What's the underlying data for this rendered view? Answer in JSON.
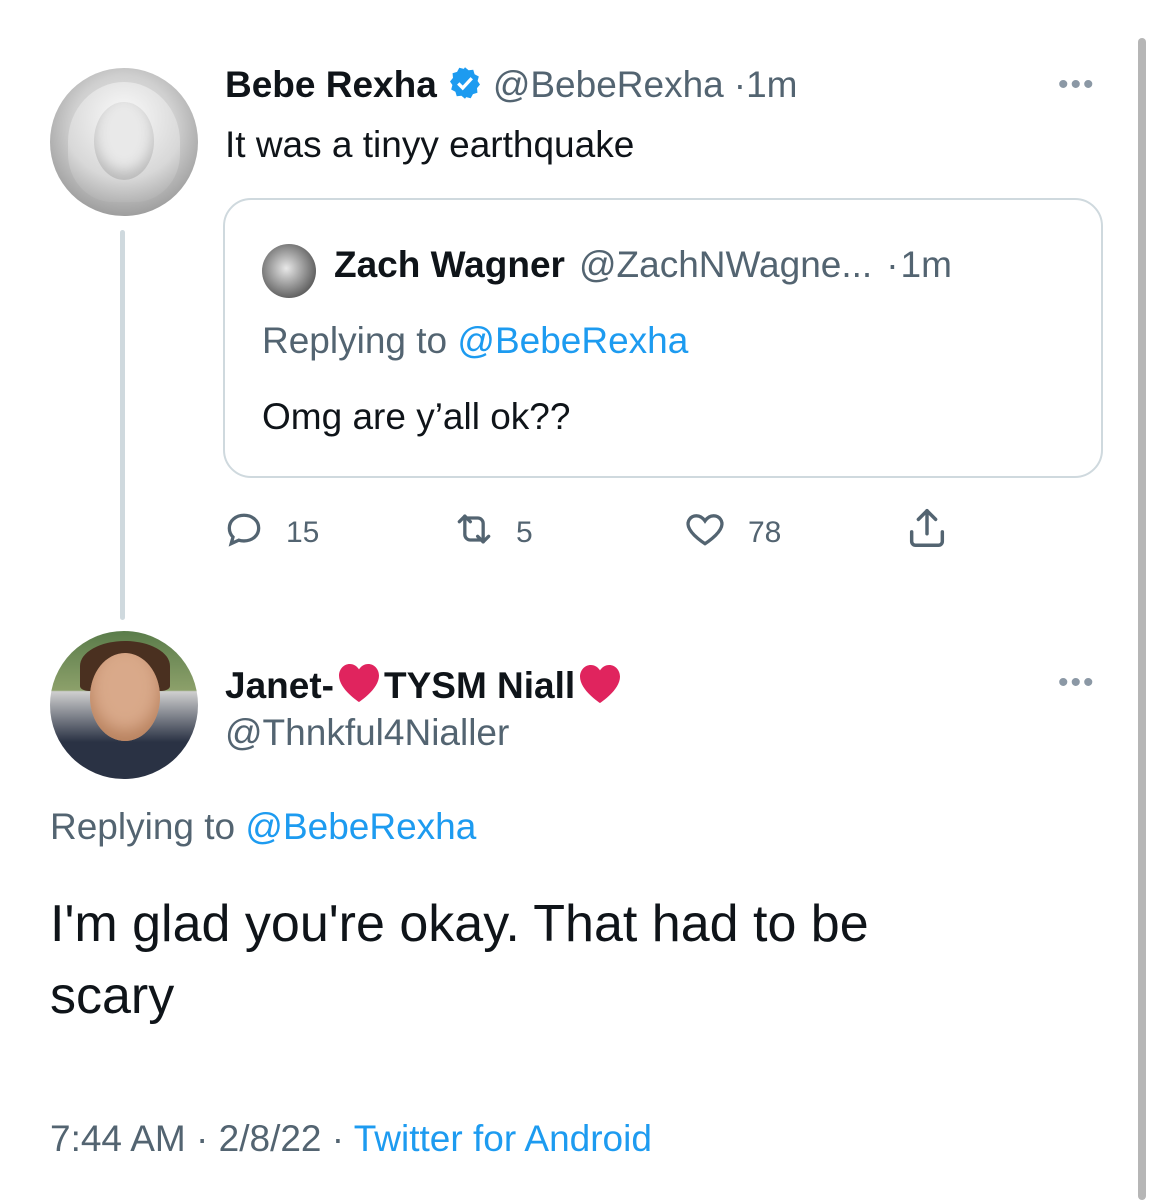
{
  "tweet": {
    "name": "Bebe Rexha",
    "handle": "@BebeRexha",
    "time": "1m",
    "text": "It was a tinyy earthquake",
    "quoted": {
      "name": "Zach Wagner",
      "handle": "@ZachNWagne...",
      "time": "1m",
      "replying_label": "Replying to",
      "replying_to": "@BebeRexha",
      "text": "Omg are y’all ok??"
    },
    "stats": {
      "replies": "15",
      "retweets": "5",
      "likes": "78"
    }
  },
  "reply": {
    "name_prefix": "Janet-",
    "name_mid": "TYSM Niall",
    "handle": "@Thnkful4Nialler",
    "replying_label": "Replying to",
    "replying_to": "@BebeRexha",
    "text_line1": "I'm glad you're okay. That had to be",
    "text_line2": "scary",
    "timestamp": "7:44 AM · 2/8/22 ·",
    "source": "Twitter for Android"
  },
  "icons": {
    "verified": "verified-badge-icon",
    "reply": "reply-icon",
    "retweet": "retweet-icon",
    "like": "heart-icon",
    "share": "share-icon",
    "more": "more-icon",
    "heart_emoji": "red-heart-emoji"
  },
  "colors": {
    "link": "#1d9bf0",
    "muted": "#536471",
    "verified": "#1d9bf0",
    "heart": "#e0245e"
  }
}
